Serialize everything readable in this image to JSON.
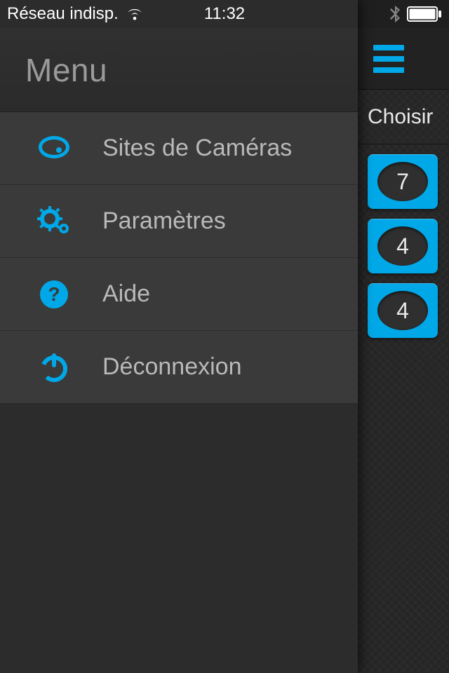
{
  "status": {
    "carrier_text": "Réseau indisp.",
    "time": "11:32"
  },
  "drawer": {
    "title": "Menu",
    "items": [
      {
        "label": "Sites de Caméras",
        "icon": "camera-icon"
      },
      {
        "label": "Paramètres",
        "icon": "gears-icon"
      },
      {
        "label": "Aide",
        "icon": "help-icon"
      },
      {
        "label": "Déconnexion",
        "icon": "power-icon"
      }
    ]
  },
  "behind": {
    "header_text_partial": "Choisir",
    "tiles": [
      {
        "count": "7"
      },
      {
        "count": "4"
      },
      {
        "count": "4"
      }
    ]
  },
  "colors": {
    "accent": "#00a8e8"
  }
}
